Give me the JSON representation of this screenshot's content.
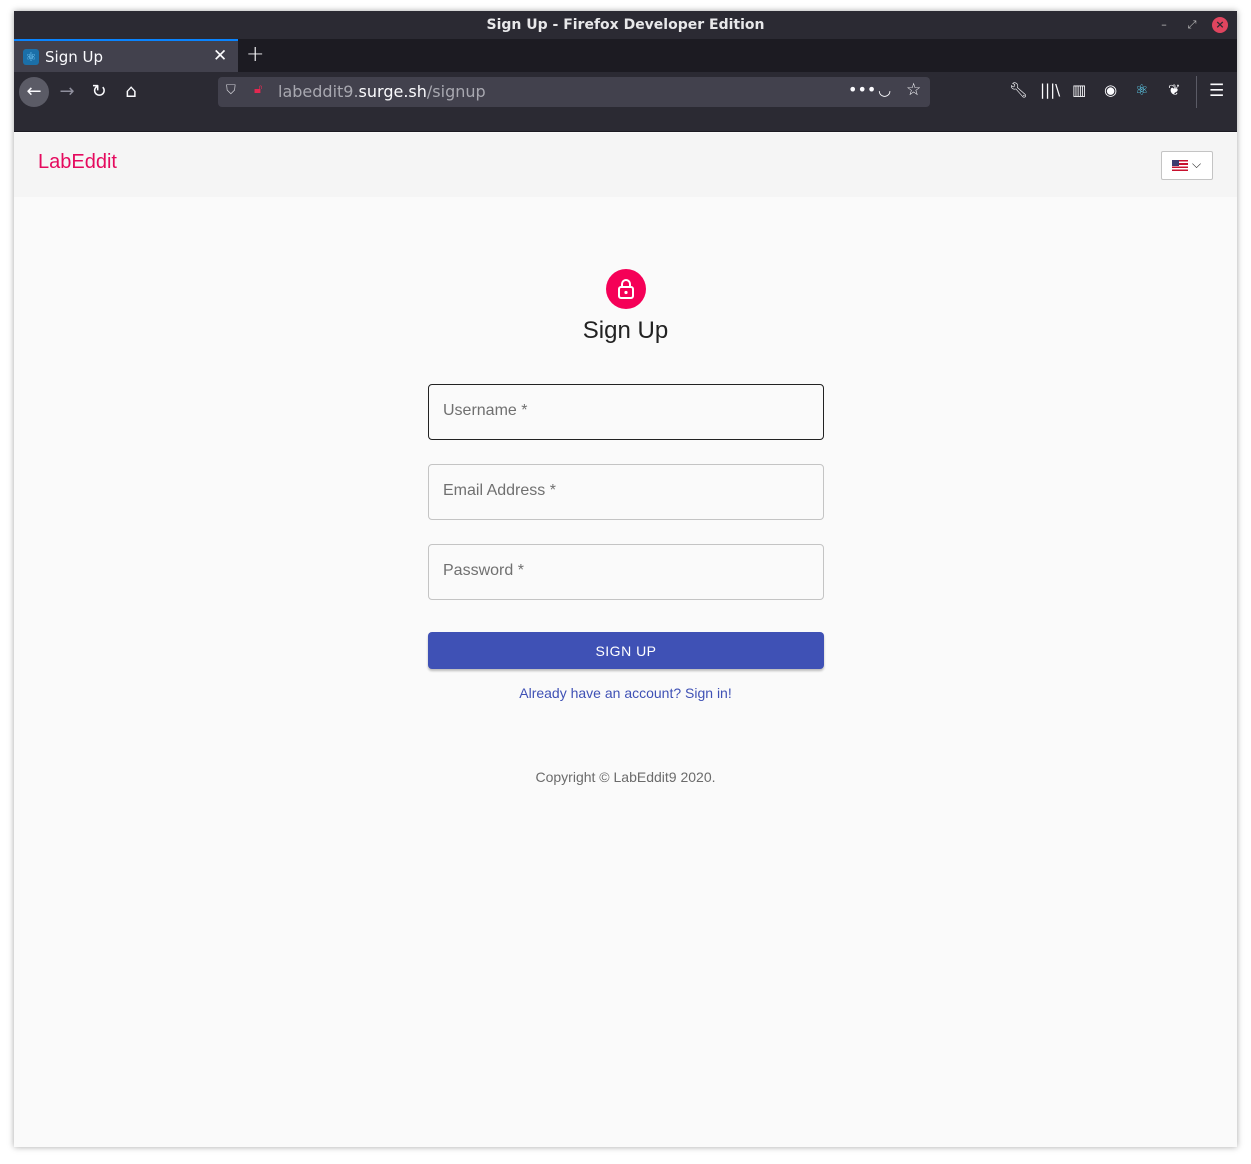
{
  "window": {
    "title": "Sign Up - Firefox Developer Edition"
  },
  "tab": {
    "label": "Sign Up"
  },
  "urlbar": {
    "prefix": "labeddit9.",
    "host": "surge.sh",
    "path": "/signup"
  },
  "app": {
    "brand": "LabEddit"
  },
  "form": {
    "heading": "Sign Up",
    "username_label": "Username *",
    "email_label": "Email Address *",
    "password_label": "Password *",
    "submit_label": "SIGN UP",
    "signin_link": "Already have an account? Sign in!"
  },
  "footer": {
    "copyright": "Copyright © LabEddit9 2020."
  },
  "colors": {
    "brand": "#e50a5e",
    "primary": "#3f51b5",
    "avatar": "#f50057"
  }
}
